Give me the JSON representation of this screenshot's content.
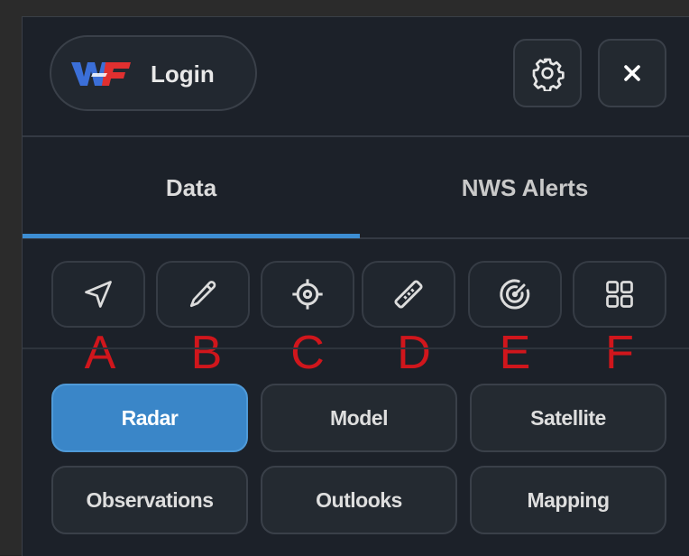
{
  "header": {
    "login_label": "Login",
    "logo_text": "WF",
    "settings_icon": "gear-icon",
    "close_icon": "close-icon"
  },
  "tabs": [
    {
      "label": "Data",
      "active": true
    },
    {
      "label": "NWS Alerts",
      "active": false
    }
  ],
  "tools": [
    {
      "icon": "navigate-arrow-icon",
      "letter": "A"
    },
    {
      "icon": "pencil-icon",
      "letter": "B"
    },
    {
      "icon": "crosshair-icon",
      "letter": "C"
    },
    {
      "icon": "ruler-icon",
      "letter": "D"
    },
    {
      "icon": "radar-icon",
      "letter": "E"
    },
    {
      "icon": "grid-icon",
      "letter": "F"
    }
  ],
  "categories": [
    {
      "label": "Radar",
      "active": true
    },
    {
      "label": "Model",
      "active": false
    },
    {
      "label": "Satellite",
      "active": false
    },
    {
      "label": "Observations",
      "active": false
    },
    {
      "label": "Outlooks",
      "active": false
    },
    {
      "label": "Mapping",
      "active": false
    }
  ],
  "colors": {
    "accent": "#3a86c8",
    "annotation_letter": "#d0161c",
    "panel_bg": "#1c2129"
  }
}
